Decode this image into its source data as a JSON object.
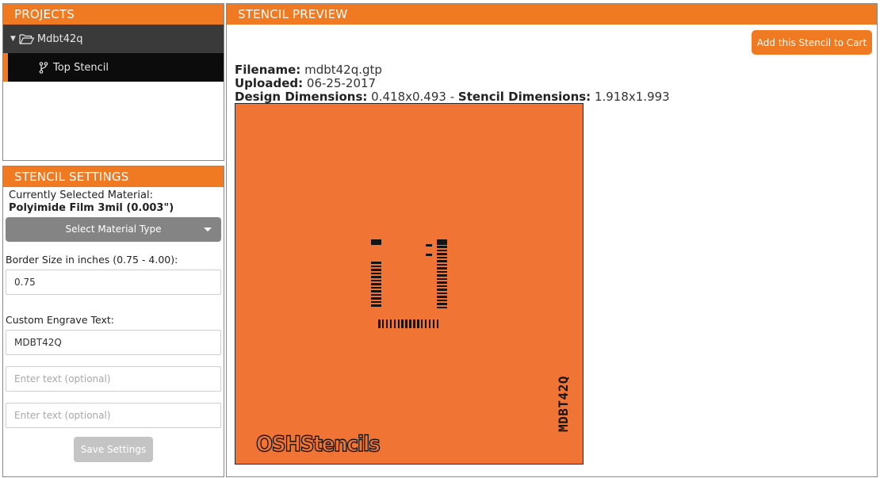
{
  "projects": {
    "header": "PROJECTS",
    "project_name": "Mdbt42q",
    "stencil_name": "Top Stencil"
  },
  "settings": {
    "header": "STENCIL SETTINGS",
    "current_material_label": "Currently Selected Material:",
    "current_material_value": "Polyimide Film 3mil (0.003\")",
    "select_material_label": "Select Material Type",
    "border_label": "Border Size in inches (0.75 - 4.00):",
    "border_value": "0.75",
    "engrave_label": "Custom Engrave Text:",
    "engrave_value": "MDBT42Q",
    "optional_placeholder_1": "Enter text (optional)",
    "optional_placeholder_2": "Enter text (optional)",
    "save_label": "Save Settings"
  },
  "preview": {
    "header": "STENCIL PREVIEW",
    "cart_button": "Add this Stencil to Cart",
    "filename_label": "Filename:",
    "filename_value": "mdbt42q.gtp",
    "uploaded_label": "Uploaded:",
    "uploaded_value": "06-25-2017",
    "design_dim_label": "Design Dimensions:",
    "design_dim_value": "0.418x0.493",
    "dim_separator": " - ",
    "stencil_dim_label": "Stencil Dimensions:",
    "stencil_dim_value": "1.918x1.993",
    "engrave_text": "MDBT42Q",
    "logo_text": "OSHStencils"
  },
  "colors": {
    "accent": "#f07a22",
    "stencil": "#f07534",
    "dark_row": "#3a3a3a",
    "selected_row": "#0c0c0c"
  }
}
